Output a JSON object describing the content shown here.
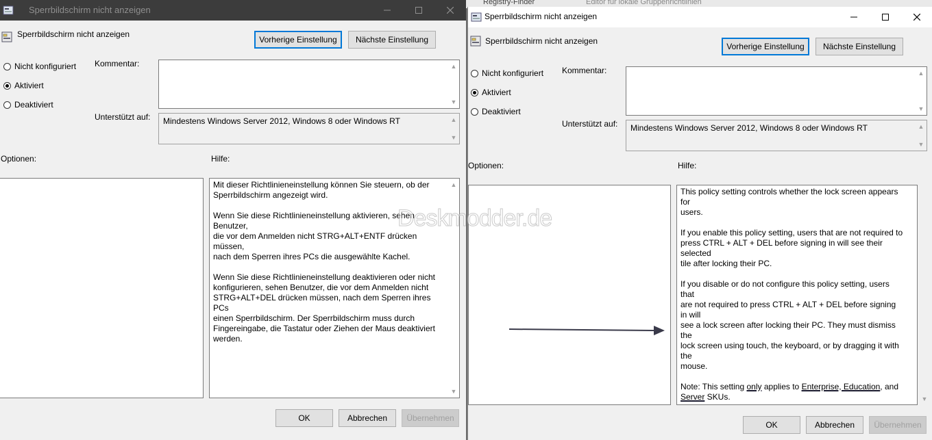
{
  "background_window": {
    "tab1": "Registry-Finder",
    "tab2": "Editor für lokale Gruppenrichtlinien"
  },
  "left": {
    "title": "Sperrbildschirm nicht anzeigen",
    "setting_name": "Sperrbildschirm nicht anzeigen",
    "prev_button": "Vorherige Einstellung",
    "next_button": "Nächste Einstellung",
    "radio_not_configured": "Nicht konfiguriert",
    "radio_enabled": "Aktiviert",
    "radio_disabled": "Deaktiviert",
    "selected": "Aktiviert",
    "comment_label": "Kommentar:",
    "comment_value": "",
    "supported_label": "Unterstützt auf:",
    "supported_value": "Mindestens Windows Server 2012, Windows 8 oder Windows RT",
    "options_label": "Optionen:",
    "help_label": "Hilfe:",
    "help_paragraphs": [
      "Mit dieser Richtlinieneinstellung können Sie steuern, ob der\nSperrbildschirm angezeigt wird.",
      "Wenn Sie diese Richtlinieneinstellung aktivieren, sehen Benutzer,\ndie vor dem Anmelden nicht STRG+ALT+ENTF drücken müssen,\nnach dem Sperren ihres PCs die ausgewählte Kachel.",
      "Wenn Sie diese Richtlinieneinstellung deaktivieren oder nicht\nkonfigurieren, sehen Benutzer, die vor dem Anmelden nicht\nSTRG+ALT+DEL drücken müssen, nach dem Sperren ihres PCs\neinen Sperrbildschirm. Der Sperrbildschirm muss durch\nFingereingabe, die Tastatur oder Ziehen der Maus deaktiviert\nwerden."
    ],
    "ok_button": "OK",
    "cancel_button": "Abbrechen",
    "apply_button": "Übernehmen"
  },
  "right": {
    "title": "Sperrbildschirm nicht anzeigen",
    "setting_name": "Sperrbildschirm nicht anzeigen",
    "prev_button": "Vorherige Einstellung",
    "next_button": "Nächste Einstellung",
    "radio_not_configured": "Nicht konfiguriert",
    "radio_enabled": "Aktiviert",
    "radio_disabled": "Deaktiviert",
    "selected": "Aktiviert",
    "comment_label": "Kommentar:",
    "comment_value": "",
    "supported_label": "Unterstützt auf:",
    "supported_value": "Mindestens Windows Server 2012, Windows 8 oder Windows RT",
    "options_label": "Optionen:",
    "help_label": "Hilfe:",
    "help_p1": "This policy setting controls whether the lock screen appears for\nusers.",
    "help_p2": "If you enable this policy setting, users that are not required to\npress CTRL + ALT + DEL before signing in will see their selected\ntile after locking their PC.",
    "help_p3": "If you disable or do not configure this policy setting, users that\nare not required to press CTRL + ALT + DEL before signing in will\nsee a lock screen after locking their PC. They must dismiss the\nlock screen using touch, the keyboard, or by dragging it with the\nmouse.",
    "note": {
      "prefix": "Note: This setting ",
      "only": "only",
      "middle": " applies to ",
      "enterprise_education": "Enterprise, Education",
      "and": ", and",
      "server": "Server",
      "suffix": " SKUs."
    },
    "ok_button": "OK",
    "cancel_button": "Abbrechen",
    "apply_button": "Übernehmen"
  },
  "watermark": "Deskmodder.de",
  "colors": {
    "accent": "#0078d7",
    "dialog_bg": "#f0f0f0",
    "annotation": "#3a3a4a"
  },
  "icons": {
    "title_icon": "policy-setting-icon",
    "setting_icon": "policy-setting-icon",
    "minimize": "minimize-icon",
    "maximize": "maximize-icon",
    "close": "close-icon"
  }
}
